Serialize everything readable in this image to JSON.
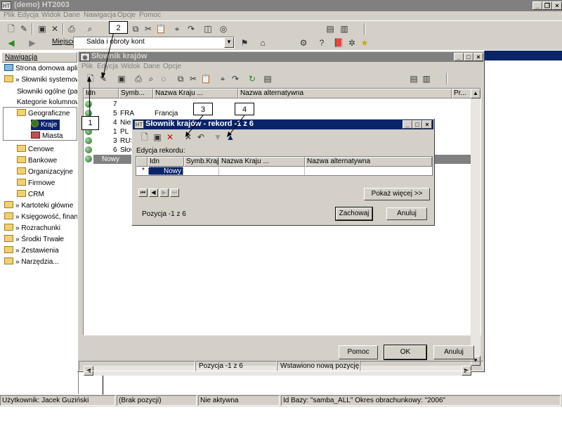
{
  "app": {
    "title": "(demo)  HT2003",
    "logo": "HT"
  },
  "menu": [
    "Plik",
    "Edycja",
    "Widok",
    "Dane",
    "Nawigacja",
    "Opcje",
    "Pomoc"
  ],
  "toolbar2": {
    "place_label": "Miejsce",
    "place_value": "Salda i obroty kont"
  },
  "sidebar": {
    "header": "Nawigacja",
    "items": [
      {
        "label": "Strona domowa aplikacji",
        "indent": 0
      },
      {
        "label": "» Słowniki systemowe",
        "indent": 0
      },
      {
        "label": "Słowniki ogólne (pa",
        "indent": 1
      },
      {
        "label": "Kategorie kolumnowe",
        "indent": 1
      },
      {
        "label": "Geograficzne",
        "indent": 1
      },
      {
        "label": "Kraje",
        "indent": 2
      },
      {
        "label": "Miasta",
        "indent": 2
      },
      {
        "label": "Cenowe",
        "indent": 1
      },
      {
        "label": "Bankowe",
        "indent": 1
      },
      {
        "label": "Organizacyjne",
        "indent": 1
      },
      {
        "label": "Firmowe",
        "indent": 1
      },
      {
        "label": "CRM",
        "indent": 1
      },
      {
        "label": "» Kartoteki główne",
        "indent": 0
      },
      {
        "label": "» Księgowość, finanse",
        "indent": 0
      },
      {
        "label": "» Rozrachunki",
        "indent": 0
      },
      {
        "label": "» Środki Trwałe",
        "indent": 0
      },
      {
        "label": "» Zestawienia",
        "indent": 0
      },
      {
        "label": "» Narzędzia...",
        "indent": 0
      }
    ]
  },
  "dict_window": {
    "title": "Słownik krajów",
    "menu": [
      "Plik",
      "Edycja",
      "Widok",
      "Dane",
      "Opcje"
    ],
    "columns": [
      "Idn",
      "Symb...",
      "Nazwa Kraju ...",
      "Nazwa alternatywna",
      "Pr..."
    ],
    "rows": [
      {
        "num": "7",
        "symb": "",
        "name": ""
      },
      {
        "num": "5",
        "symb": "FRA",
        "name": "Francja"
      },
      {
        "num": "4",
        "symb": "Niem",
        "name": ""
      },
      {
        "num": "1",
        "symb": "PL",
        "name": ""
      },
      {
        "num": "3",
        "symb": "RUS",
        "name": ""
      },
      {
        "num": "6",
        "symb": "Słow",
        "name": ""
      }
    ],
    "new_row_label": "Nowy",
    "buttons": {
      "help": "Pomoc",
      "ok": "OK",
      "cancel": "Anuluj"
    },
    "status": {
      "position": "Pozycja -1 z 6",
      "message": "Wstawiono nową pozycję..."
    }
  },
  "record_window": {
    "title": "Słownik krajów - rekord -1 z 6",
    "section_label": "Edycja rekordu:",
    "columns": [
      "Idn",
      "Symb.Kraju",
      "Nazwa Kraju ...",
      "Nazwa alternatywna"
    ],
    "row_marker": "*",
    "row_value": "Nowy",
    "more_button": "Pokaż więcej >>",
    "position": "Pozycja -1 z 6",
    "save_button": "Zachowaj",
    "cancel_button": "Anuluj"
  },
  "callouts": [
    "1",
    "2",
    "3",
    "4"
  ],
  "statusbar": {
    "user": "Użytkownik: Jacek Guziński",
    "position": "(Brak pozycji)",
    "state": "Nie aktywna",
    "db": "Id Bazy: \"samba_ALL\" Okres obrachunkowy: \"2006\""
  }
}
